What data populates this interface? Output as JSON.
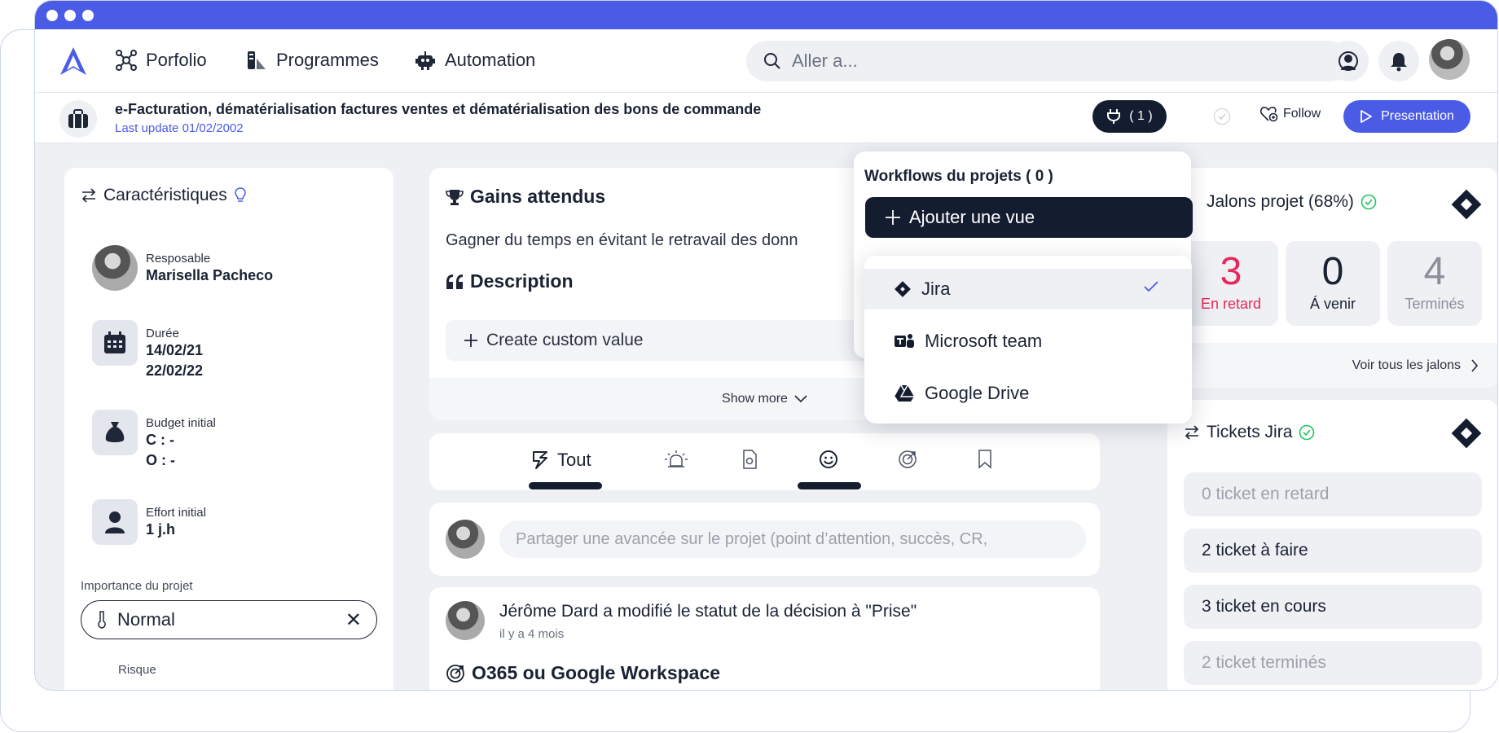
{
  "nav": {
    "items": [
      {
        "label": "Porfolio",
        "icon": "portfolio-icon"
      },
      {
        "label": "Programmes",
        "icon": "programmes-icon"
      },
      {
        "label": "Automation",
        "icon": "robot-icon"
      }
    ],
    "search_placeholder": "Aller a..."
  },
  "project": {
    "title": "e-Facturation, dématérialisation factures ventes et dématérialisation  des bons de commande",
    "last_update": "Last update 01/02/2002",
    "plugins_count": "( 1 )",
    "follow_label": "Follow",
    "presentation_label": "Presentation"
  },
  "caracteristiques": {
    "title": "Caractéristiques",
    "responsable_label": "Resposable",
    "responsable_value": "Marisella Pacheco",
    "duree_label": "Durée",
    "duree_start": "14/02/21",
    "duree_end": "22/02/22",
    "budget_label": "Budget initial",
    "budget_c": "C : -",
    "budget_o": "O : -",
    "effort_label": "Effort initial",
    "effort_value": "1 j.h",
    "importance_label": "Importance du projet",
    "importance_value": "Normal",
    "risque_label": "Risque"
  },
  "gains": {
    "title": "Gains attendus",
    "text": "Gagner du temps en évitant le retravail des donn",
    "description_title": "Description",
    "custom_value_label": "Create custom value",
    "show_more": "Show more"
  },
  "tabs": {
    "tout_label": "Tout"
  },
  "share": {
    "placeholder": "Partager une avancée sur le projet (point d’attention, succès, CR,"
  },
  "feed": {
    "title": "Jérôme Dard a modifié le statut de la décision à \"Prise\"",
    "time": "il y a 4 mois",
    "subtitle": "O365 ou Google Workspace"
  },
  "jalons": {
    "title": "Jalons projet (68%)",
    "stats": [
      {
        "value": "3",
        "label": "En retard",
        "color": "#e8285a"
      },
      {
        "value": "0",
        "label": "Á venir",
        "color": "#1a2233"
      },
      {
        "value": "4",
        "label": "Terminés",
        "color": "#8a8f9a"
      }
    ],
    "voir_tous": "Voir tous les jalons"
  },
  "tickets": {
    "title": "Tickets Jira",
    "rows": [
      {
        "label": "0 ticket en retard",
        "color": "#9ca1ab"
      },
      {
        "label": "2 ticket à faire",
        "color": "#1a2233"
      },
      {
        "label": "3 ticket en cours",
        "color": "#1a2233"
      },
      {
        "label": "2 ticket terminés",
        "color": "#9ca1ab"
      }
    ]
  },
  "workflows": {
    "title": "Workflows du projets ( 0 )",
    "add_label": "Ajouter une vue",
    "options": [
      {
        "label": "Jira",
        "icon": "jira-icon",
        "selected": true
      },
      {
        "label": "Microsoft team",
        "icon": "teams-icon",
        "selected": false
      },
      {
        "label": "Google Drive",
        "icon": "google-drive-icon",
        "selected": false
      }
    ]
  },
  "colors": {
    "accent": "#4a5ce6",
    "dark": "#141c30",
    "success": "#22c55e",
    "danger": "#e8285a"
  }
}
